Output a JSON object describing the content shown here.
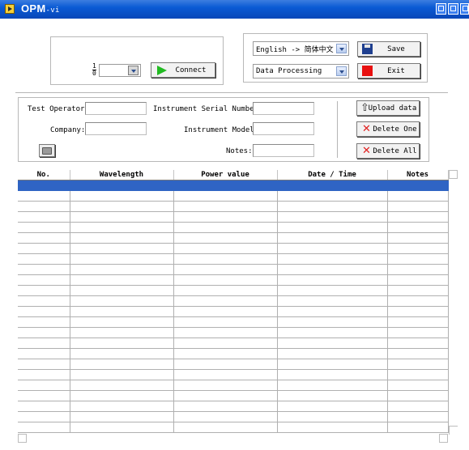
{
  "window": {
    "title": "OPM",
    "title_ext": "-vi"
  },
  "connect_panel": {
    "fraction_label": "1/0",
    "port_value": "",
    "connect_label": "Connect"
  },
  "language": {
    "value": "English -> 简体中文"
  },
  "mode": {
    "value": "Data Processing"
  },
  "save_label": "Save",
  "exit_label": "Exit",
  "info": {
    "test_operator_label": "Test Operator:",
    "test_operator_value": "",
    "company_label": "Company:",
    "company_value": "",
    "serial_label": "Instrument Serial Number:",
    "serial_value": "",
    "model_label": "Instrument Model:",
    "model_value": "",
    "notes_label": "Notes:",
    "notes_value": ""
  },
  "actions": {
    "upload_label": "Upload data",
    "delete_one_label": "Delete One",
    "delete_all_label": "Delete All"
  },
  "table": {
    "columns": [
      "No.",
      "Wavelength",
      "Power value",
      "Date / Time",
      "Notes"
    ],
    "selected_row": 0,
    "row_count": 24
  },
  "colors": {
    "titlebar": "#0a5ad4",
    "selection": "#2f64c4",
    "connect_arrow": "#22bb22",
    "exit_square": "#e81010",
    "delete_x": "#e02020"
  }
}
